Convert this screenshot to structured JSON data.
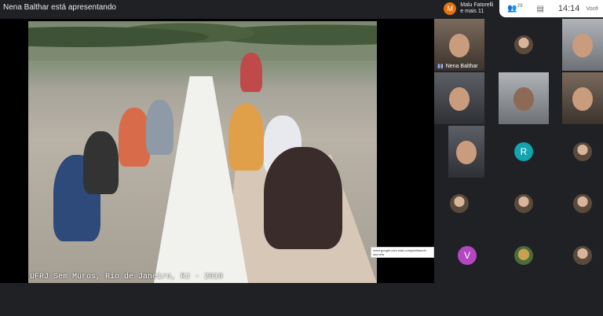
{
  "presenter": {
    "label": "Nena Balthar está apresentando"
  },
  "notification": {
    "initial": "M",
    "line1": "Malu Fatorelli",
    "line2": "e mais 11",
    "avatar_color": "#e8710a"
  },
  "tray": {
    "people_count": "29",
    "people_icon": "people-icon",
    "chat_icon": "chat-icon",
    "time": "14:14",
    "you_label": "Você"
  },
  "shared_screen": {
    "caption": "UFRJ Sem Muros, Rio de Janeiro, RJ - 2019",
    "tooltip": "meet.google.com está compartilhando sua tela"
  },
  "participants": {
    "pinned_name": "Nena Balthar",
    "avatar_r": {
      "initial": "R",
      "color": "#12a4af"
    },
    "avatar_v": {
      "initial": "V",
      "color": "#b247c0"
    }
  }
}
